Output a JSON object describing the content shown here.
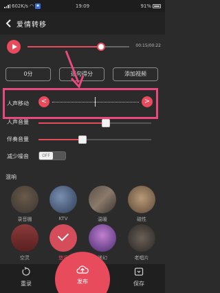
{
  "status": {
    "left_text": "602K/s",
    "time": "19:09",
    "battery": "91%"
  },
  "header": {
    "title": "爱情转移"
  },
  "player": {
    "time": "00:15/00:22",
    "progress": 0.72
  },
  "actions": {
    "score": "0分",
    "sentence_score": "逐句得分",
    "add_video": "添加视频"
  },
  "voice_adjust": {
    "label": "人声移动",
    "left_btn": "<",
    "right_btn": ">"
  },
  "mix": {
    "vocal_label": "人声音量",
    "vocal_level": 0.6,
    "accomp_label": "伴奏音量",
    "accomp_level": 0.39,
    "noise_label": "减少噪音",
    "noise_state": "OFF"
  },
  "reverb": {
    "title": "混响",
    "effects": [
      {
        "label": "录音棚",
        "selected": false
      },
      {
        "label": "KTV",
        "selected": false
      },
      {
        "label": "温暖",
        "selected": false
      },
      {
        "label": "磁性",
        "selected": false
      },
      {
        "label": "空灵",
        "selected": false
      },
      {
        "label": "悠远",
        "selected": true
      },
      {
        "label": "迷幻",
        "selected": false
      },
      {
        "label": "老唱片",
        "selected": false
      }
    ]
  },
  "bottom": {
    "rerecord": "重录",
    "publish": "发布",
    "save": "保存"
  },
  "colors": {
    "accent": "#e84b5c",
    "highlight": "#e84a7f"
  }
}
